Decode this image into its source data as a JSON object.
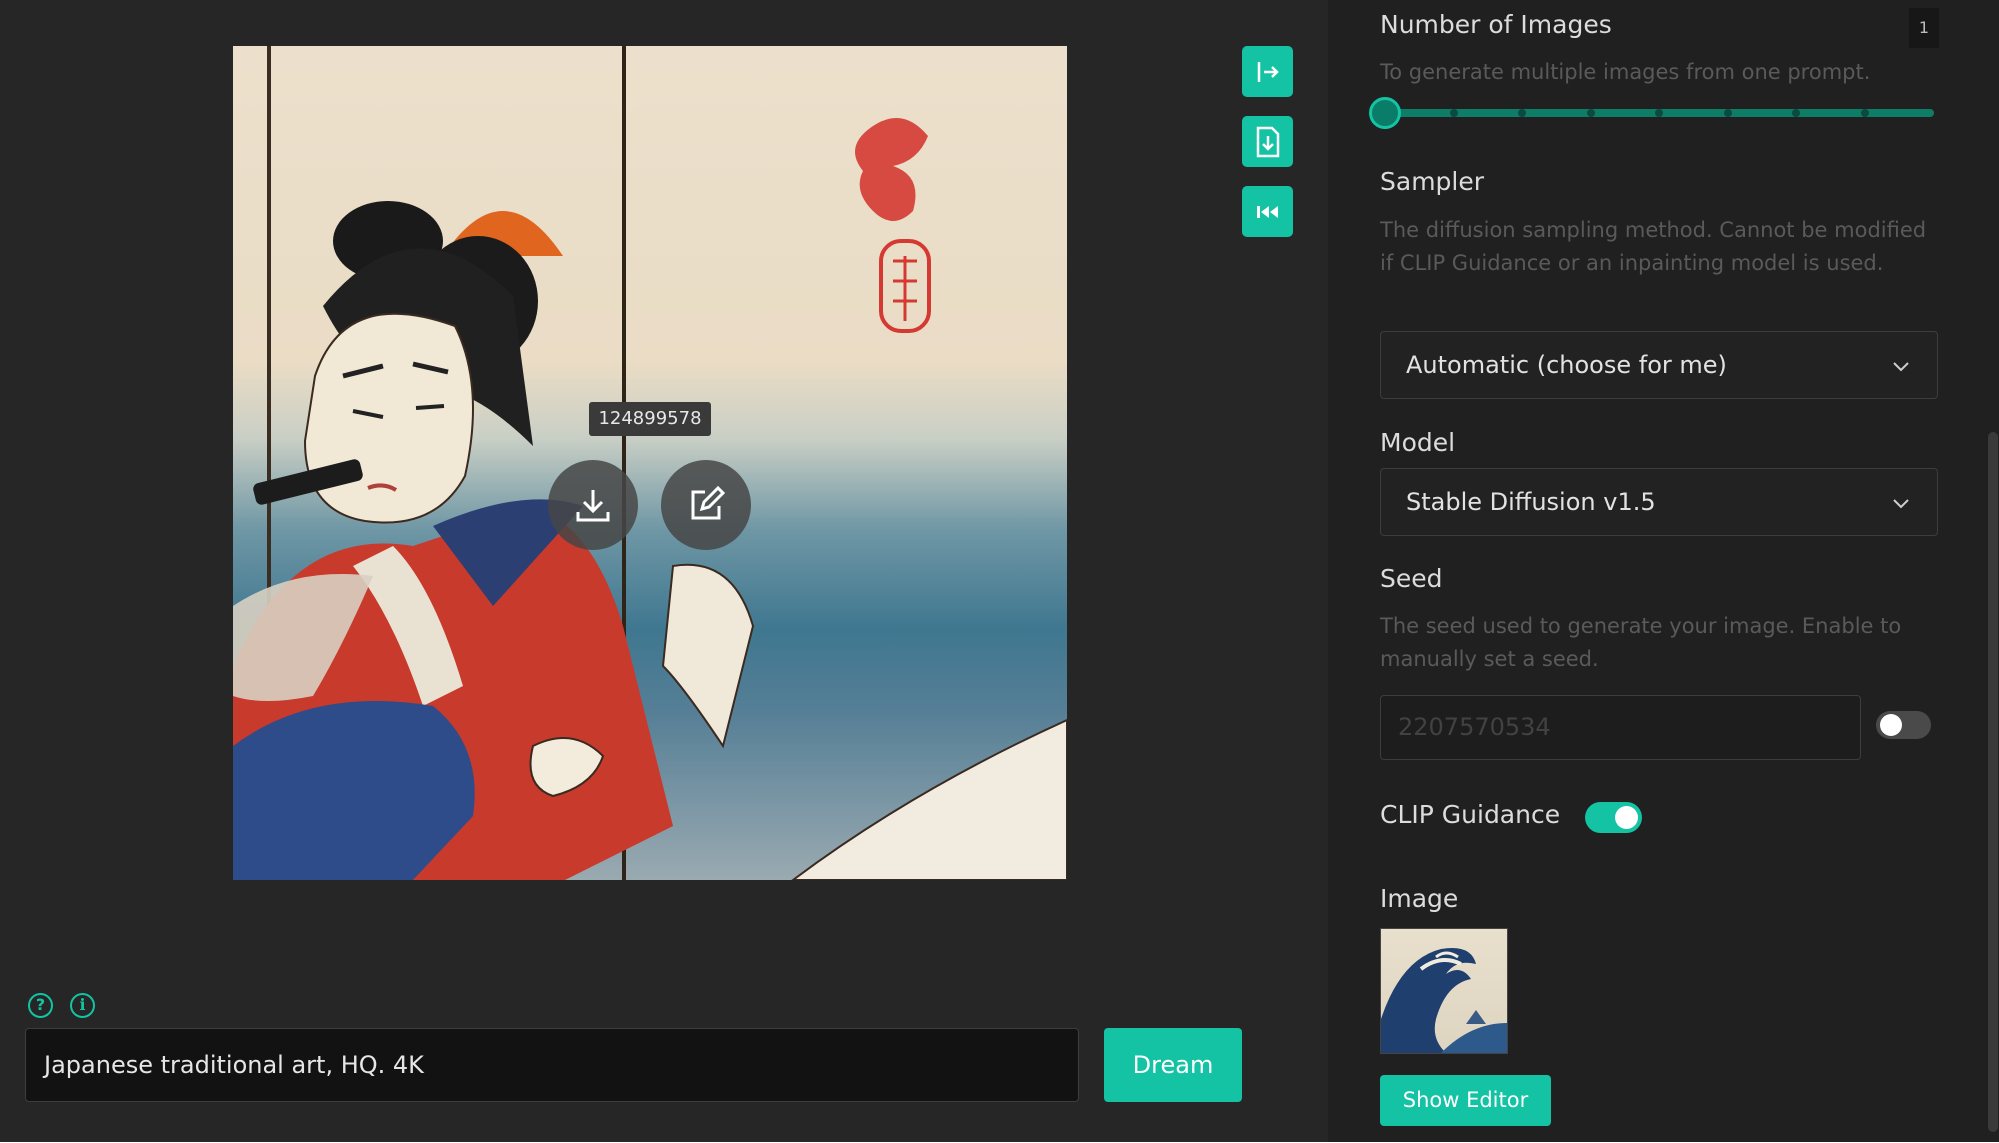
{
  "theme": {
    "accent": "#13c3a3",
    "left_bg": "#262626",
    "right_bg": "#202020"
  },
  "canvas": {
    "image_subject": "Japanese woodblock-style portrait",
    "seed_tooltip": "124899578",
    "overlay_icons": [
      "download-icon",
      "edit-icon"
    ]
  },
  "side_actions": [
    {
      "name": "collapse-panel",
      "icon": "arrow-right-bar-icon"
    },
    {
      "name": "export-file",
      "icon": "file-download-icon"
    },
    {
      "name": "restart",
      "icon": "rewind-icon"
    }
  ],
  "prompt": {
    "help_icon": "question-circle-icon",
    "info_icon": "info-circle-icon",
    "text": "Japanese traditional art,  HQ. 4K",
    "dream_label": "Dream"
  },
  "settings": {
    "num_images": {
      "label": "Number of Images",
      "value": "1",
      "description": "To generate multiple images from one prompt.",
      "slider_fraction": 0
    },
    "sampler": {
      "label": "Sampler",
      "description": "The diffusion sampling method. Cannot be modified if CLIP Guidance or an inpainting model is used.",
      "selected": "Automatic (choose for me)"
    },
    "model": {
      "label": "Model",
      "selected": "Stable Diffusion v1.5"
    },
    "seed": {
      "label": "Seed",
      "description": "The seed used to generate your image. Enable to manually set a seed.",
      "placeholder": "2207570534",
      "manual_enabled": false
    },
    "clip_guidance": {
      "label": "CLIP Guidance",
      "enabled": true
    },
    "image": {
      "label": "Image",
      "thumbnail_subject": "great wave woodblock print",
      "show_editor_label": "Show Editor"
    }
  }
}
